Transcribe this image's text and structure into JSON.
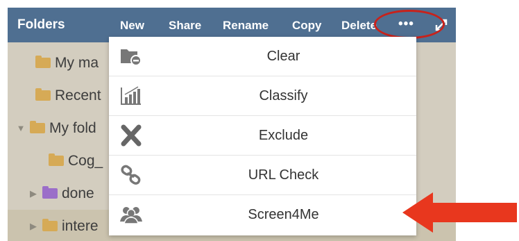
{
  "header": {
    "title": "Folders",
    "toolbar": {
      "new_label": "New",
      "share_label": "Share",
      "rename_label": "Rename",
      "copy_label": "Copy",
      "delete_label": "Delete",
      "more_label": "•••"
    }
  },
  "tree": {
    "items": [
      {
        "label": "My ma",
        "folder_color": "#d6aa56",
        "expandable": false
      },
      {
        "label": "Recent",
        "folder_color": "#d6aa56",
        "expandable": false
      },
      {
        "label": "My fold",
        "folder_color": "#d6aa56",
        "expandable": true,
        "expanded": true
      },
      {
        "label": "Cog_",
        "folder_color": "#d6aa56",
        "expandable": false
      },
      {
        "label": "done",
        "folder_color": "#9b6ec9",
        "expandable": true,
        "expanded": false
      },
      {
        "label": "intere",
        "folder_color": "#d6aa56",
        "expandable": true,
        "expanded": false,
        "selected": true
      }
    ]
  },
  "menu": {
    "items": [
      {
        "label": "Clear",
        "icon": "folder-clear-icon"
      },
      {
        "label": "Classify",
        "icon": "bar-chart-icon"
      },
      {
        "label": "Exclude",
        "icon": "x-icon"
      },
      {
        "label": "URL Check",
        "icon": "link-icon"
      },
      {
        "label": "Screen4Me",
        "icon": "users-icon"
      }
    ]
  },
  "colors": {
    "header_bg": "#4f6f91",
    "panel_bg": "#d3cdbf",
    "highlight_red": "#c8221b",
    "arrow_red": "#e8371e"
  }
}
